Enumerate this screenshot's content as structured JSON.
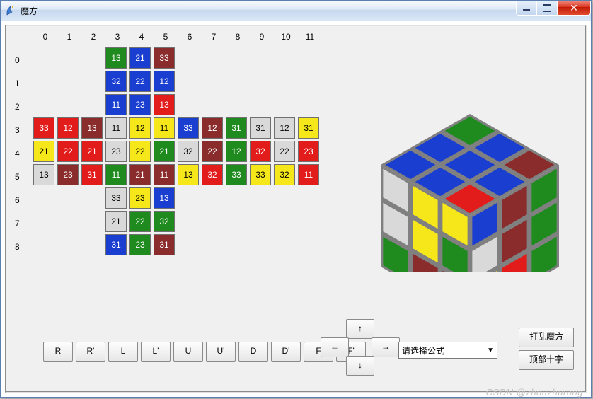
{
  "window": {
    "title": "魔方"
  },
  "watermark": "CSDN @zhouzhurong",
  "columns": [
    "0",
    "1",
    "2",
    "3",
    "4",
    "5",
    "6",
    "7",
    "8",
    "9",
    "10",
    "11"
  ],
  "rows": [
    "0",
    "1",
    "2",
    "3",
    "4",
    "5",
    "6",
    "7",
    "8"
  ],
  "colors": {
    "green": "#1f8b1f",
    "blue": "#1a3ed0",
    "darkred": "#8a2c2c",
    "red": "#e21b1b",
    "yellow": "#f5e71a",
    "grey": "#d9d9d9",
    "frame": "#808080",
    "white": "#ffffff"
  },
  "cells": [
    {
      "r": 0,
      "c": 3,
      "v": "13",
      "k": "green"
    },
    {
      "r": 0,
      "c": 4,
      "v": "21",
      "k": "blue"
    },
    {
      "r": 0,
      "c": 5,
      "v": "33",
      "k": "darkred"
    },
    {
      "r": 1,
      "c": 3,
      "v": "32",
      "k": "blue"
    },
    {
      "r": 1,
      "c": 4,
      "v": "22",
      "k": "blue"
    },
    {
      "r": 1,
      "c": 5,
      "v": "12",
      "k": "blue"
    },
    {
      "r": 2,
      "c": 3,
      "v": "11",
      "k": "blue"
    },
    {
      "r": 2,
      "c": 4,
      "v": "23",
      "k": "blue"
    },
    {
      "r": 2,
      "c": 5,
      "v": "13",
      "k": "red"
    },
    {
      "r": 3,
      "c": 0,
      "v": "33",
      "k": "red"
    },
    {
      "r": 3,
      "c": 1,
      "v": "12",
      "k": "red"
    },
    {
      "r": 3,
      "c": 2,
      "v": "13",
      "k": "darkred"
    },
    {
      "r": 3,
      "c": 3,
      "v": "11",
      "k": "grey"
    },
    {
      "r": 3,
      "c": 4,
      "v": "12",
      "k": "yellow"
    },
    {
      "r": 3,
      "c": 5,
      "v": "11",
      "k": "yellow"
    },
    {
      "r": 3,
      "c": 6,
      "v": "33",
      "k": "blue"
    },
    {
      "r": 3,
      "c": 7,
      "v": "12",
      "k": "darkred"
    },
    {
      "r": 3,
      "c": 8,
      "v": "31",
      "k": "green"
    },
    {
      "r": 3,
      "c": 9,
      "v": "31",
      "k": "grey"
    },
    {
      "r": 3,
      "c": 10,
      "v": "12",
      "k": "grey"
    },
    {
      "r": 3,
      "c": 11,
      "v": "31",
      "k": "yellow"
    },
    {
      "r": 4,
      "c": 0,
      "v": "21",
      "k": "yellow"
    },
    {
      "r": 4,
      "c": 1,
      "v": "22",
      "k": "red"
    },
    {
      "r": 4,
      "c": 2,
      "v": "21",
      "k": "red"
    },
    {
      "r": 4,
      "c": 3,
      "v": "23",
      "k": "grey"
    },
    {
      "r": 4,
      "c": 4,
      "v": "22",
      "k": "yellow"
    },
    {
      "r": 4,
      "c": 5,
      "v": "21",
      "k": "green"
    },
    {
      "r": 4,
      "c": 6,
      "v": "32",
      "k": "grey"
    },
    {
      "r": 4,
      "c": 7,
      "v": "22",
      "k": "darkred"
    },
    {
      "r": 4,
      "c": 8,
      "v": "12",
      "k": "green"
    },
    {
      "r": 4,
      "c": 9,
      "v": "32",
      "k": "red"
    },
    {
      "r": 4,
      "c": 10,
      "v": "22",
      "k": "grey"
    },
    {
      "r": 4,
      "c": 11,
      "v": "23",
      "k": "red"
    },
    {
      "r": 5,
      "c": 0,
      "v": "13",
      "k": "grey"
    },
    {
      "r": 5,
      "c": 1,
      "v": "23",
      "k": "darkred"
    },
    {
      "r": 5,
      "c": 2,
      "v": "31",
      "k": "red"
    },
    {
      "r": 5,
      "c": 3,
      "v": "11",
      "k": "green"
    },
    {
      "r": 5,
      "c": 4,
      "v": "21",
      "k": "darkred"
    },
    {
      "r": 5,
      "c": 5,
      "v": "11",
      "k": "darkred"
    },
    {
      "r": 5,
      "c": 6,
      "v": "13",
      "k": "yellow"
    },
    {
      "r": 5,
      "c": 7,
      "v": "32",
      "k": "red"
    },
    {
      "r": 5,
      "c": 8,
      "v": "33",
      "k": "green"
    },
    {
      "r": 5,
      "c": 9,
      "v": "33",
      "k": "yellow"
    },
    {
      "r": 5,
      "c": 10,
      "v": "32",
      "k": "yellow"
    },
    {
      "r": 5,
      "c": 11,
      "v": "11",
      "k": "red"
    },
    {
      "r": 6,
      "c": 3,
      "v": "33",
      "k": "grey"
    },
    {
      "r": 6,
      "c": 4,
      "v": "23",
      "k": "yellow"
    },
    {
      "r": 6,
      "c": 5,
      "v": "13",
      "k": "blue"
    },
    {
      "r": 7,
      "c": 3,
      "v": "21",
      "k": "grey"
    },
    {
      "r": 7,
      "c": 4,
      "v": "22",
      "k": "green"
    },
    {
      "r": 7,
      "c": 5,
      "v": "32",
      "k": "green"
    },
    {
      "r": 8,
      "c": 3,
      "v": "31",
      "k": "blue"
    },
    {
      "r": 8,
      "c": 4,
      "v": "23",
      "k": "green"
    },
    {
      "r": 8,
      "c": 5,
      "v": "31",
      "k": "darkred"
    }
  ],
  "buttons": {
    "moves": [
      "R",
      "R'",
      "L",
      "L'",
      "U",
      "U'",
      "D",
      "D'",
      "F",
      "F'"
    ],
    "arrows": {
      "up": "↑",
      "down": "↓",
      "left": "←",
      "right": "→"
    },
    "dropdown_placeholder": "请选择公式",
    "scramble": "打乱魔方",
    "top_cross": "顶部十字"
  },
  "cube3d": {
    "top": [
      [
        "green",
        "blue",
        "darkred"
      ],
      [
        "blue",
        "blue",
        "blue"
      ],
      [
        "blue",
        "blue",
        "red"
      ]
    ],
    "front": [
      [
        "grey",
        "yellow",
        "yellow"
      ],
      [
        "grey",
        "yellow",
        "green"
      ],
      [
        "green",
        "darkred",
        "darkred"
      ]
    ],
    "right": [
      [
        "blue",
        "darkred",
        "green"
      ],
      [
        "grey",
        "darkred",
        "green"
      ],
      [
        "yellow",
        "red",
        "green"
      ]
    ]
  }
}
